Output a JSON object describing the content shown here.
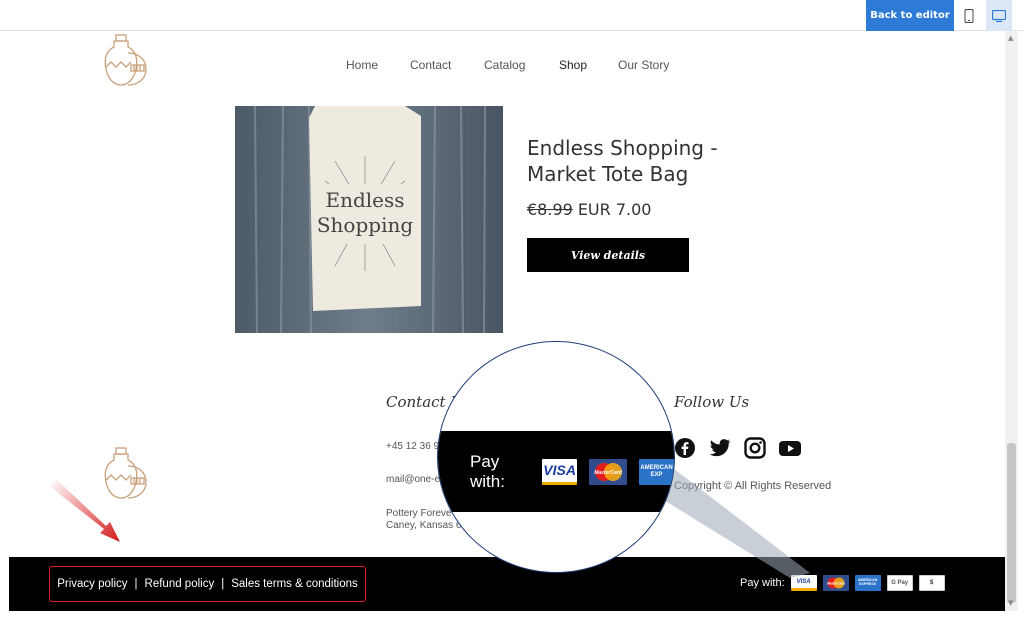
{
  "editor_bar": {
    "back_label": "Back to editor",
    "mobile_icon": "mobile-device-icon",
    "desktop_icon": "desktop-device-icon"
  },
  "nav": {
    "items": [
      "Home",
      "Contact",
      "Catalog",
      "Shop",
      "Our Story"
    ],
    "active": "Shop"
  },
  "product": {
    "image_text_line1": "Endless",
    "image_text_line2": "Shopping",
    "title": "Endless Shopping - Market Tote Bag",
    "old_price": "€8.99",
    "price": "EUR 7.00",
    "button_label": "View details"
  },
  "footer": {
    "contact_heading": "Contact D",
    "phone": "+45 12 36 98",
    "email": "mail@one-e",
    "address_line1": "Pottery Foreve",
    "address_line2": "Caney, Kansas 6",
    "follow_heading": "Follow Us",
    "social_icons": [
      "facebook-icon",
      "twitter-icon",
      "instagram-icon",
      "youtube-icon"
    ],
    "copyright": "Copyright © All Rights Reserved",
    "policy_links": [
      "Privacy policy",
      "Refund policy",
      "Sales terms & conditions"
    ],
    "policy_separator": "|",
    "pay_label": "Pay with:",
    "cards": {
      "visa": "VISA",
      "mastercard": "MasterCard",
      "amex": "AMERICAN EXPRESS",
      "gpay": "G Pay",
      "dollar": "$"
    }
  },
  "magnifier": {
    "pay_label": "Pay with:",
    "visa": "VISA",
    "mastercard": "MasterCard",
    "amex": "AMERICAN EXP"
  },
  "colors": {
    "accent_blue": "#2d7bd6",
    "highlight_red": "#e01d1d",
    "footer_bg": "#000000",
    "logo_tan": "#c9a07a"
  }
}
